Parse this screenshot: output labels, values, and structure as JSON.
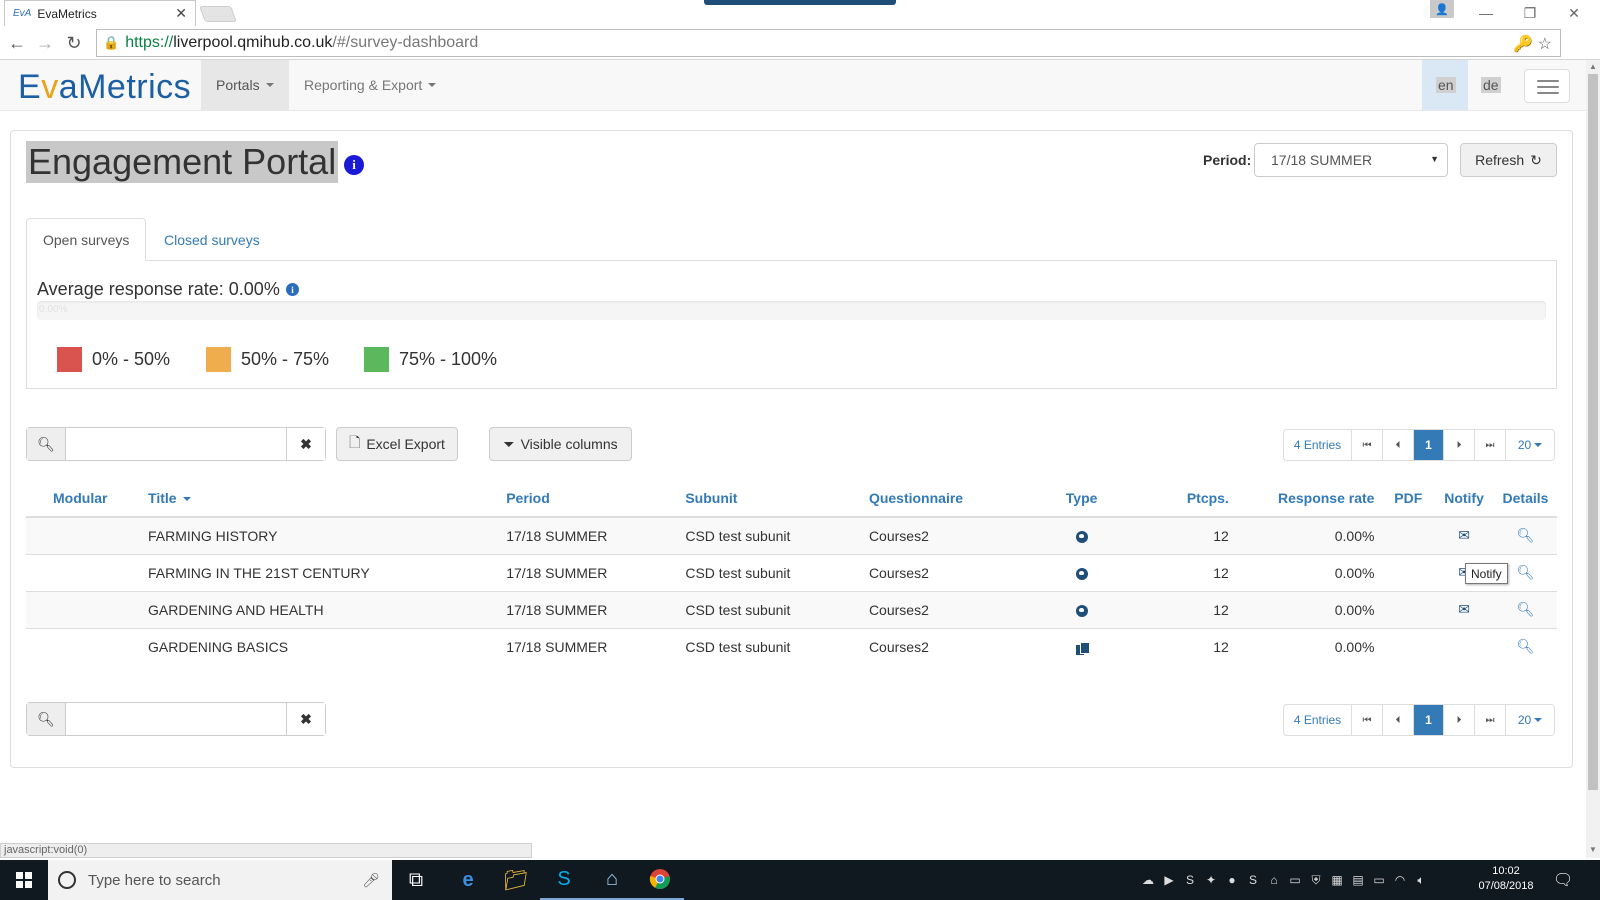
{
  "browser": {
    "tab_title": "EvaMetrics",
    "favicon_text": "EvA",
    "url_secure": "https://",
    "url_host": "liverpool.qmihub.co.uk",
    "url_path": "/#/survey-dashboard",
    "status_url": "javascript:void(0)"
  },
  "nav": {
    "logo_e": "E",
    "logo_v": "v",
    "logo_rest": "aMetrics",
    "portals": "Portals",
    "reporting": "Reporting & Export",
    "lang_en": "en",
    "lang_de": "de"
  },
  "page": {
    "title": "Engagement Portal",
    "period_label": "Period:",
    "period_value": "17/18 SUMMER",
    "refresh_label": "Refresh"
  },
  "tabs": {
    "open": "Open surveys",
    "closed": "Closed surveys"
  },
  "summary": {
    "avg_label": "Average response rate: 0.00%",
    "progress_text": "0.00%",
    "progress_value": 0,
    "legend": [
      {
        "label": "0% - 50%",
        "color": "#d9534f"
      },
      {
        "label": "50% - 75%",
        "color": "#f0ad4e"
      },
      {
        "label": "75% - 100%",
        "color": "#5cb85c"
      }
    ]
  },
  "toolbar": {
    "search_placeholder": "",
    "excel_export": "Excel Export",
    "visible_columns": "Visible columns"
  },
  "pager": {
    "entries": "4 Entries",
    "current_page": "1",
    "page_size": "20"
  },
  "table": {
    "headers": {
      "modular": "Modular",
      "title": "Title",
      "period": "Period",
      "subunit": "Subunit",
      "questionnaire": "Questionnaire",
      "type": "Type",
      "ptcps": "Ptcps.",
      "rate": "Response rate",
      "pdf": "PDF",
      "notify": "Notify",
      "details": "Details"
    },
    "rows": [
      {
        "title": "FARMING HISTORY",
        "period": "17/18 SUMMER",
        "subunit": "CSD test subunit",
        "questionnaire": "Courses2",
        "type": "globe-icon",
        "ptcps": "12",
        "rate": "0.00%"
      },
      {
        "title": "FARMING IN THE 21ST CENTURY",
        "period": "17/18 SUMMER",
        "subunit": "CSD test subunit",
        "questionnaire": "Courses2",
        "type": "globe-icon",
        "ptcps": "12",
        "rate": "0.00%"
      },
      {
        "title": "GARDENING AND HEALTH",
        "period": "17/18 SUMMER",
        "subunit": "CSD test subunit",
        "questionnaire": "Courses2",
        "type": "globe-icon",
        "ptcps": "12",
        "rate": "0.00%"
      },
      {
        "title": "GARDENING BASICS",
        "period": "17/18 SUMMER",
        "subunit": "CSD test subunit",
        "questionnaire": "Courses2",
        "type": "paper-documents-icon",
        "ptcps": "12",
        "rate": "0.00%"
      }
    ],
    "tooltip": "Notify"
  },
  "taskbar": {
    "search_placeholder": "Type here to search",
    "time": "10:02",
    "date": "07/08/2018"
  },
  "colors": {
    "accent": "#337ab7",
    "info": "#1a1ad6",
    "icon_dark": "#1f4e79"
  }
}
